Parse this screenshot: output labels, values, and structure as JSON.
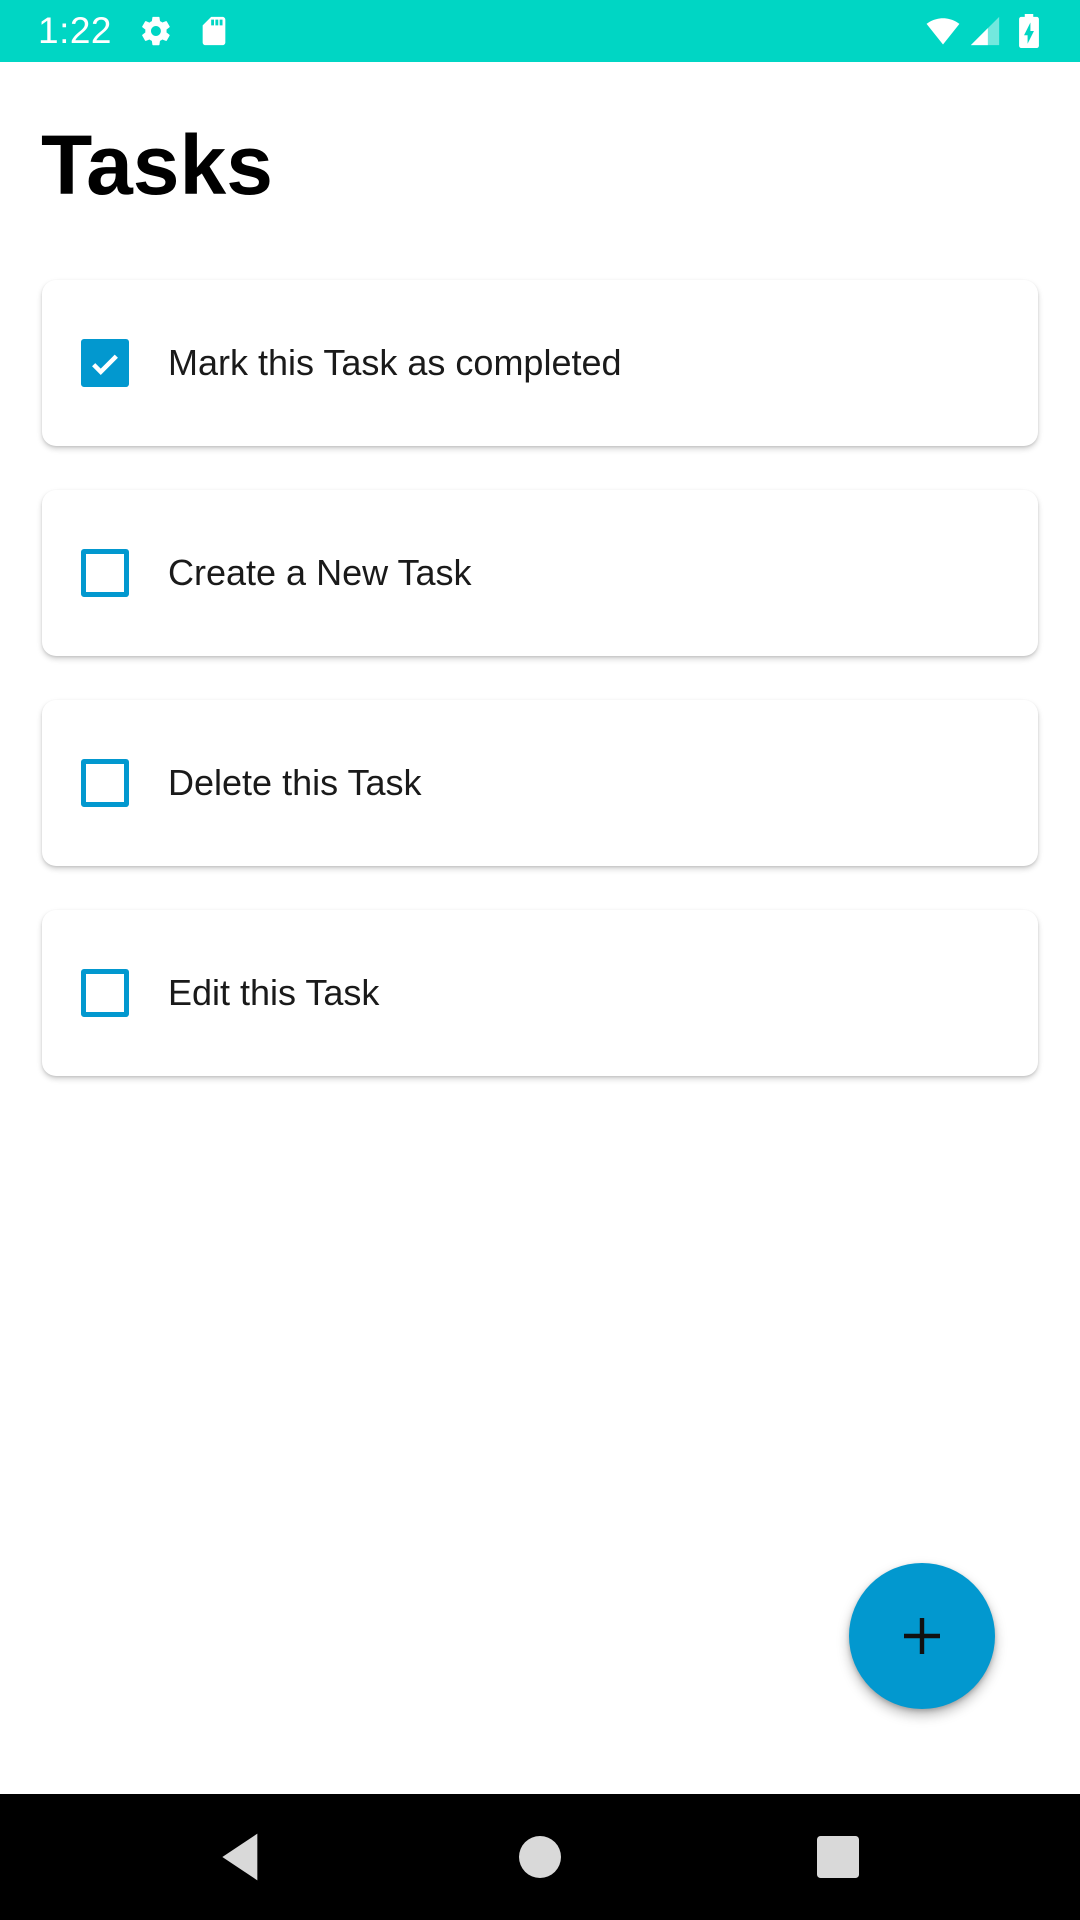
{
  "status_bar": {
    "time": "1:22",
    "background_color": "#00d6c4",
    "icons": [
      "settings-icon",
      "sd-card-icon",
      "wifi-icon",
      "cellular-signal-icon",
      "battery-charging-icon"
    ]
  },
  "page": {
    "title": "Tasks"
  },
  "tasks": [
    {
      "label": "Mark this Task as completed",
      "checked": true
    },
    {
      "label": "Create a New Task",
      "checked": false
    },
    {
      "label": "Delete this Task",
      "checked": false
    },
    {
      "label": "Edit this Task",
      "checked": false
    }
  ],
  "fab": {
    "icon": "plus-icon",
    "color": "#0298cf"
  },
  "nav_bar": {
    "buttons": [
      "back-icon",
      "home-icon",
      "recents-icon"
    ]
  },
  "accent_color": "#0298cf"
}
